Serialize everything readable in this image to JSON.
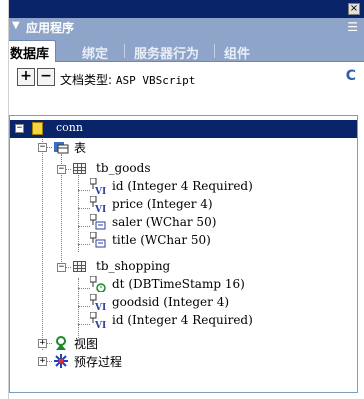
{
  "window": {
    "close_glyph": "×"
  },
  "panel": {
    "title": "应用程序",
    "arrow": "▼",
    "options_glyph": "☰"
  },
  "tabs": [
    {
      "label": "数据库",
      "active": true
    },
    {
      "label": "绑定",
      "active": false
    },
    {
      "label": "服务器行为",
      "active": false
    },
    {
      "label": "组件",
      "active": false
    }
  ],
  "toolbar": {
    "add_label": "+",
    "remove_label": "−",
    "doctype_label": "文档类型:",
    "doctype_value": "ASP VBScript",
    "refresh_glyph": "C"
  },
  "tree": {
    "connection": "conn",
    "tables_folder": "表",
    "tables": [
      {
        "name": "tb_goods",
        "columns": [
          {
            "text": "id (Integer 4 Required)",
            "kind": "VI"
          },
          {
            "text": "price (Integer 4)",
            "kind": "VI"
          },
          {
            "text": "saler (WChar 50)",
            "kind": "text"
          },
          {
            "text": "title (WChar 50)",
            "kind": "text"
          }
        ]
      },
      {
        "name": "tb_shopping",
        "columns": [
          {
            "text": "dt (DBTimeStamp 16)",
            "kind": "time"
          },
          {
            "text": "goodsid (Integer 4)",
            "kind": "VI"
          },
          {
            "text": "id (Integer 4 Required)",
            "kind": "VI"
          }
        ]
      }
    ],
    "views_folder": "视图",
    "procs_folder": "预存过程"
  },
  "colors": {
    "selected_bg": "#0a246a",
    "panel_bg": "#8ea4c8",
    "titlebar_bg": "#0a246a"
  }
}
